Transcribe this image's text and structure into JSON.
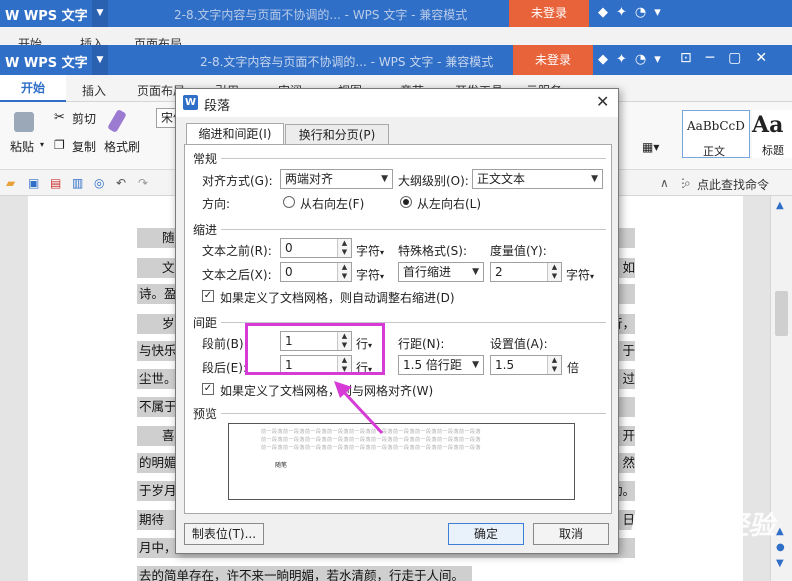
{
  "background_window": {
    "app_name": "WPS 文字",
    "doc_title": "2-8.文字内容与页面不协调的... - WPS 文字 - 兼容模式",
    "login_label": "未登录",
    "menu": [
      "开始",
      "插入",
      "页面布局",
      "引用",
      "审阅",
      "视图",
      "章节",
      "开发工具",
      "云服务"
    ]
  },
  "window": {
    "app_name": "WPS 文字",
    "doc_title": "2-8.文字内容与页面不协调的... - WPS 文字 - 兼容模式",
    "login_label": "未登录"
  },
  "menubar": {
    "tabs": [
      "开始",
      "插入",
      "页面布局",
      "引用",
      "审阅",
      "视图",
      "章节",
      "开发工具",
      "云服务"
    ]
  },
  "ribbon": {
    "paste": "粘贴",
    "cut": "剪切",
    "copy": "复制",
    "format_painter": "格式刷",
    "font_prefix": "宋体",
    "style_preview": "AaBbCcD",
    "style_normal": "正文",
    "style_heading_preview": "Aa",
    "style_heading": "标题"
  },
  "quick_access": {
    "find_command": "点此查找命令"
  },
  "document": {
    "lines": [
      {
        "left": "随",
        "right": ""
      },
      {
        "left": "文",
        "right": "如"
      },
      {
        "left": "诗。盈盈",
        "right": ""
      },
      {
        "left": "岁",
        "right": "行，"
      },
      {
        "left": "与快乐",
        "right": "于"
      },
      {
        "left": "尘世。",
        "right": "过"
      },
      {
        "left": "不属于",
        "right": ""
      },
      {
        "left": "喜",
        "right": "开"
      },
      {
        "left": "的明媚",
        "right": "然"
      },
      {
        "left": "于岁月",
        "right": "动。"
      },
      {
        "left": "期待",
        "right": "日"
      },
      {
        "left": "月中，",
        "right": ""
      },
      {
        "left": "去的简单存在，许不来一晌明媚，若水清颜，行走于人间。",
        "right": ""
      }
    ]
  },
  "dialog": {
    "title": "段落",
    "tabs": [
      "缩进和间距(I)",
      "换行和分页(P)"
    ],
    "general": {
      "section": "常规",
      "alignment_label": "对齐方式(G):",
      "alignment_value": "两端对齐",
      "outline_label": "大纲级别(O):",
      "outline_value": "正文文本",
      "direction_label": "方向:",
      "rtl_label": "从右向左(F)",
      "ltr_label": "从左向右(L)"
    },
    "indent": {
      "section": "缩进",
      "before_label": "文本之前(R):",
      "before_value": "0",
      "before_unit": "字符",
      "after_label": "文本之后(X):",
      "after_value": "0",
      "after_unit": "字符",
      "special_label": "特殊格式(S):",
      "special_value": "首行缩进",
      "measure_label": "度量值(Y):",
      "measure_value": "2",
      "measure_unit": "字符",
      "auto_adjust_label": "如果定义了文档网格，则自动调整右缩进(D)"
    },
    "spacing": {
      "section": "间距",
      "before_label": "段前(B):",
      "before_value": "1",
      "before_unit": "行",
      "after_label": "段后(E):",
      "after_value": "1",
      "after_unit": "行",
      "line_label": "行距(N):",
      "line_value": "1.5 倍行距",
      "setting_label": "设置值(A):",
      "setting_value": "1.5",
      "setting_unit": "倍",
      "grid_label": "如果定义了文档网格，则与网格对齐(W)"
    },
    "preview": {
      "section": "预览",
      "line_text": "前一段落前一段落前一段落前一段落前一段落前一段落前一段落前一段落前一段落前一段落",
      "sample_text": "随笔"
    },
    "tabstops_button": "制表位(T)...",
    "ok_button": "确定",
    "cancel_button": "取消"
  },
  "watermark": {
    "brand": "Baidu 经验",
    "url": "jingyan.baidu.com"
  },
  "colors": {
    "title_blue": "#2f6fc7",
    "login_orange": "#e8623a",
    "highlight_magenta": "#d63bd6"
  }
}
